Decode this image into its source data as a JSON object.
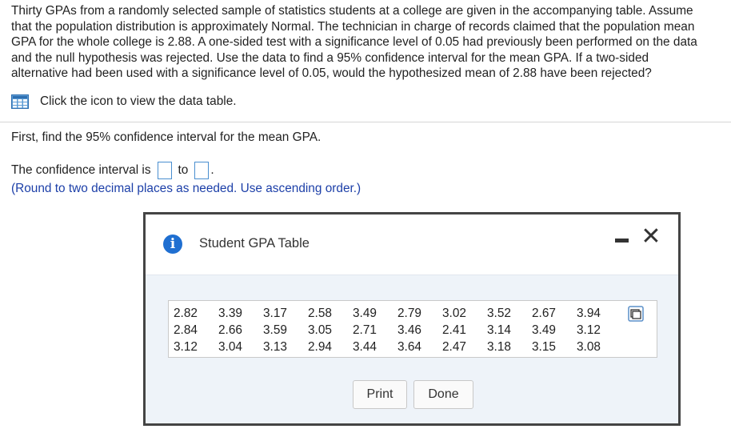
{
  "problem": {
    "lines": [
      "Thirty GPAs from a randomly selected sample of statistics students at a college are given in the accompanying table. Assume",
      "that the population distribution is approximately Normal. The technician in charge of records claimed that the population mean",
      "GPA for the whole college is 2.88. A one-sided test with a significance level of 0.05 had previously been performed on the data",
      "and the null hypothesis was rejected. Use the data to find a 95% confidence interval for the mean GPA. If a two-sided",
      "alternative had been used with a significance level of 0.05, would the hypothesized mean of 2.88 have been rejected?"
    ],
    "data_link_text": "Click the icon to view the data table.",
    "data_link_icon": "table-icon"
  },
  "question": {
    "first_text": "First, find the 95% confidence interval for the mean GPA.",
    "ci_prefix": "The confidence interval is",
    "ci_to": "to",
    "ci_suffix": ".",
    "hint": "(Round to two decimal places as needed. Use ascending order.)"
  },
  "modal": {
    "title": "Student GPA Table",
    "info_icon": "i",
    "close_glyph": "✕",
    "rows": [
      [
        "2.82",
        "3.39",
        "3.17",
        "2.58",
        "3.49",
        "2.79",
        "3.02",
        "3.52",
        "2.67",
        "3.94"
      ],
      [
        "2.84",
        "2.66",
        "3.59",
        "3.05",
        "2.71",
        "3.46",
        "2.41",
        "3.14",
        "3.49",
        "3.12"
      ],
      [
        "3.12",
        "3.04",
        "3.13",
        "2.94",
        "3.44",
        "3.64",
        "2.47",
        "3.18",
        "3.15",
        "3.08"
      ]
    ],
    "print_label": "Print",
    "done_label": "Done"
  },
  "colors": {
    "hint_text": "#1c3fa8",
    "info_icon_bg": "#1f6fd1",
    "modal_body_bg": "#eef3f9",
    "answer_box_border": "#4a8fd0"
  }
}
